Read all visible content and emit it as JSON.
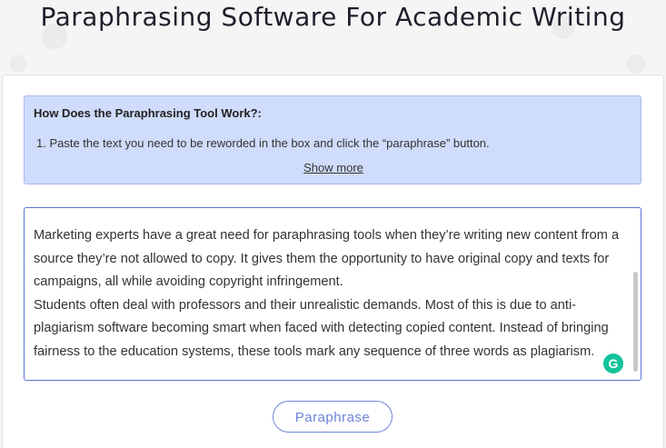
{
  "page": {
    "title": "Paraphrasing Software For Academic Writing"
  },
  "howto": {
    "title": "How Does the Paraphrasing Tool Work?:",
    "steps": [
      "1. Paste the text you need to be reworded in the box and click the “paraphrase” button."
    ],
    "show_more": "Show more"
  },
  "editor": {
    "value": "Marketing experts have a great need for paraphrasing tools when they’re writing new content from a source they’re not allowed to copy. It gives them the opportunity to have original copy and texts for campaigns, all while avoiding copyright infringement.\nStudents often deal with professors and their unrealistic demands. Most of this is due to anti-plagiarism software becoming smart when faced with detecting copied content. Instead of bringing fairness to the education systems, these tools mark any sequence of three words as plagiarism.",
    "grammarly_icon": "grammarly-icon",
    "grammarly_color": "#15c39a"
  },
  "actions": {
    "paraphrase_label": "Paraphrase"
  },
  "colors": {
    "accent": "#6d83db",
    "info_bg": "#cfdcfb"
  }
}
